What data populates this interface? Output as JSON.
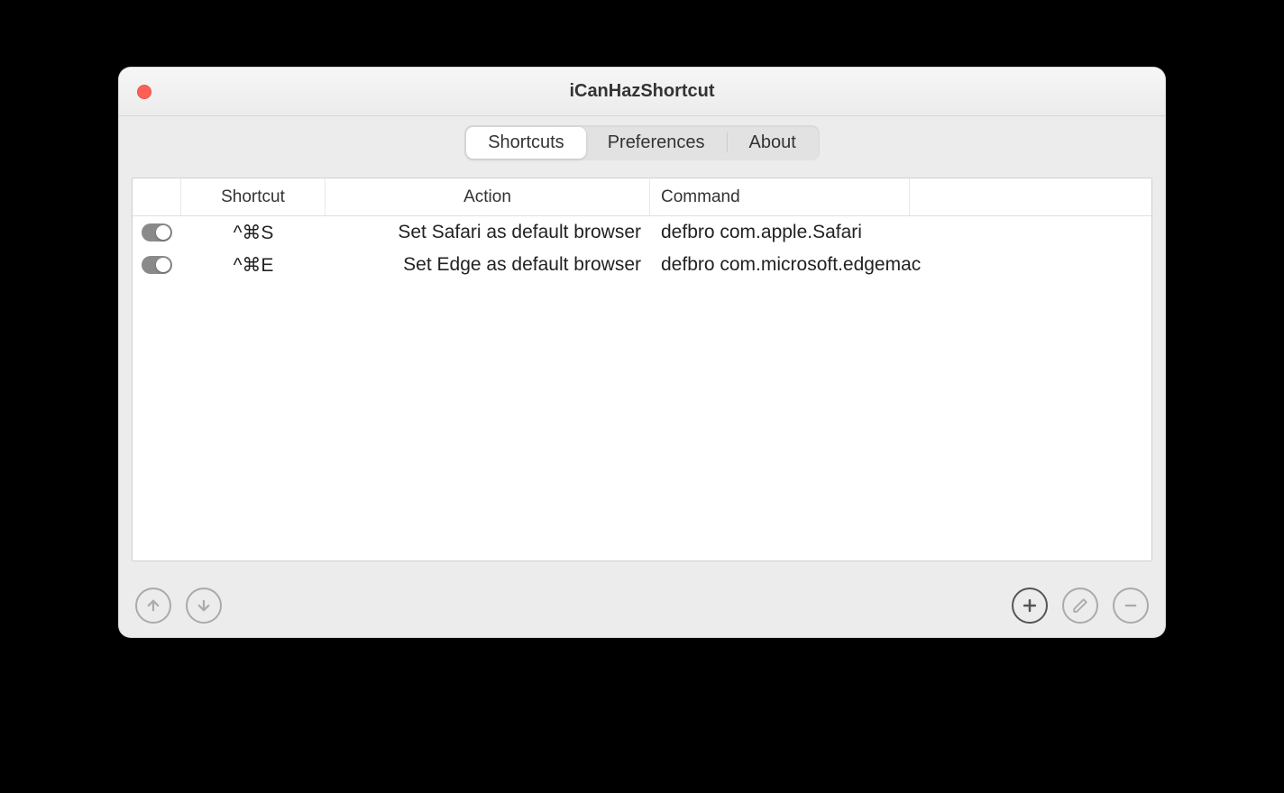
{
  "window": {
    "title": "iCanHazShortcut"
  },
  "tabs": {
    "shortcuts": "Shortcuts",
    "preferences": "Preferences",
    "about": "About",
    "active": "shortcuts"
  },
  "table": {
    "headers": {
      "shortcut": "Shortcut",
      "action": "Action",
      "command": "Command"
    },
    "rows": [
      {
        "enabled": true,
        "shortcut": "^⌘S",
        "action": "Set Safari as default browser",
        "command": "defbro com.apple.Safari"
      },
      {
        "enabled": true,
        "shortcut": "^⌘E",
        "action": "Set Edge as default browser",
        "command": "defbro com.microsoft.edgemac"
      }
    ]
  }
}
